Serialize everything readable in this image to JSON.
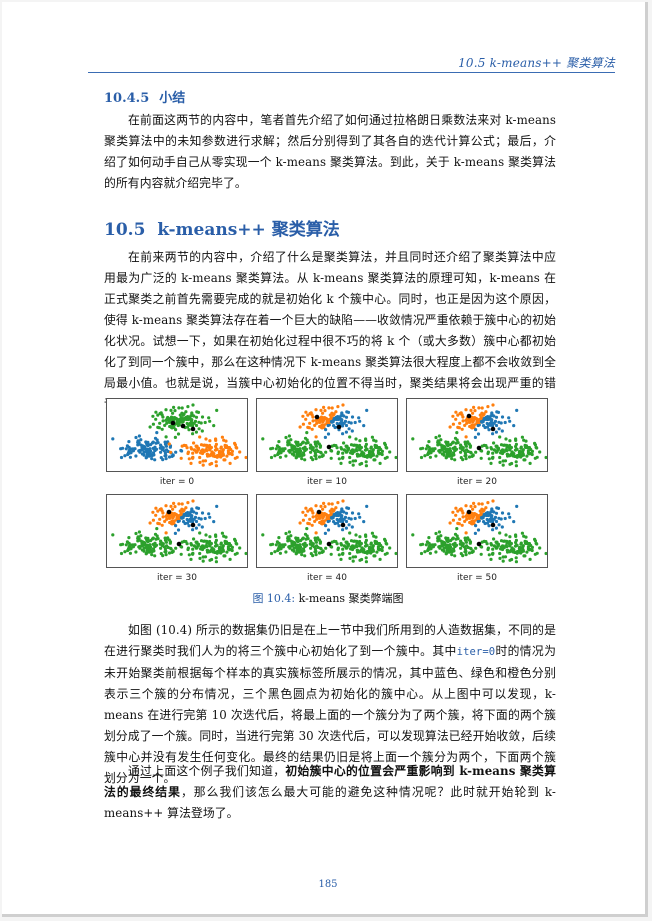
{
  "header": {
    "running_title": "10.5 k-means++ 聚类算法"
  },
  "section_454": {
    "number": "10.4.5",
    "title": "小结",
    "paragraph": "在前面这两节的内容中，笔者首先介绍了如何通过拉格朗日乘数法来对 k-means 聚类算法中的未知参数进行求解；然后分别得到了其各自的迭代计算公式；最后，介绍了如何动手自己从零实现一个 k-means 聚类算法。到此，关于 k-means 聚类算法的所有内容就介绍完毕了。"
  },
  "section_105": {
    "number": "10.5",
    "title": "k-means++ 聚类算法",
    "paragraph": "在前来两节的内容中，介绍了什么是聚类算法，并且同时还介绍了聚类算法中应用最为广泛的 k-means 聚类算法。从 k-means 聚类算法的原理可知，k-means 在正式聚类之前首先需要完成的就是初始化 k 个簇中心。同时，也正是因为这个原因，使得 k-means 聚类算法存在着一个巨大的缺陷——收敛情况严重依赖于簇中心的初始化状况。试想一下，如果在初始化过程中很不巧的将 k 个（或大多数）簇中心都初始化了到同一个簇中，那么在这种情况下 k-means 聚类算法很大程度上都不会收敛到全局最小值。也就是说，当簇中心初始化的位置不得当时，聚类结果将会出现严重的错误。"
  },
  "figure": {
    "plots": [
      {
        "label": "iter = 0"
      },
      {
        "label": "iter = 10"
      },
      {
        "label": "iter = 20"
      },
      {
        "label": "iter = 30"
      },
      {
        "label": "iter = 40"
      },
      {
        "label": "iter = 50"
      }
    ],
    "caption_number": "图 10.4:",
    "caption_text": "k-means 聚类弊端图",
    "colors": {
      "blue": "#1f77b4",
      "green": "#2ca02c",
      "orange": "#ff7f0e",
      "center": "#000000"
    }
  },
  "body_para1": {
    "part1": "如图 (10.4) 所示的数据集仍旧是在上一节中我们所用到的人造数据集，不同的是在进行聚类时我们人为的将三个簇中心初始化了到一个簇中。其中",
    "code": "iter=0",
    "part2": "时的情况为未开始聚类前根据每个样本的真实簇标签所展示的情况，其中蓝色、绿色和橙色分别表示三个簇的分布情况，三个黑色圆点为初始化的簇中心。从上图中可以发现，k-means 在进行完第 10 次迭代后，将最上面的一个簇分为了两个簇，将下面的两个簇划分成了一个簇。同时，当进行完第 30 次迭代后，可以发现算法已经开始收敛，后续簇中心并没有发生任何变化。最终的结果仍旧是将上面一个簇分为两个，下面两个簇划分为一个。"
  },
  "body_para2": {
    "part1": "通过上面这个例子我们知道，",
    "bold": "初始簇中心的位置会严重影响到 k-means 聚类算法的最终结果",
    "part2": "，那么我们该怎么最大可能的避免这种情况呢？此时就开始轮到 k-means++ 算法登场了。"
  },
  "page_number": "185"
}
